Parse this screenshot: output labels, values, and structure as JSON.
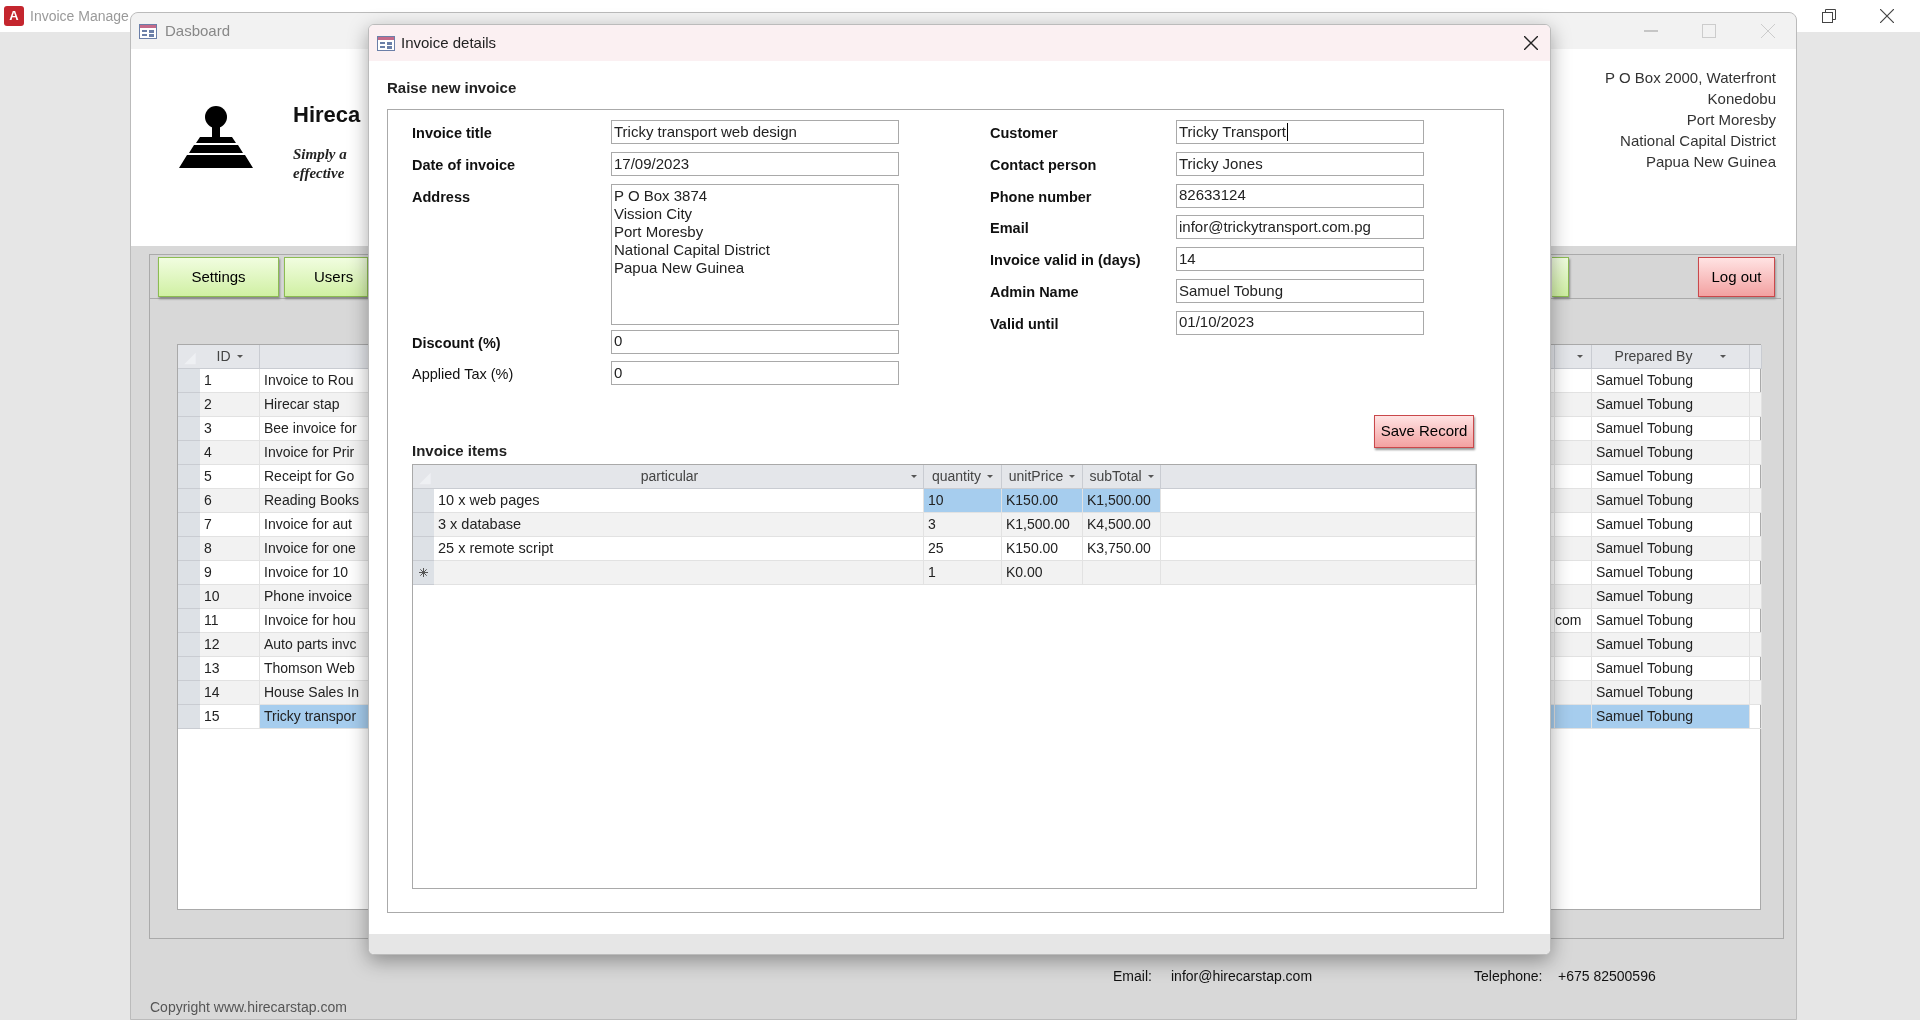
{
  "app": {
    "icon_letter": "A",
    "title": "Invoice Manage"
  },
  "dashboard": {
    "title": "Dasboard",
    "brand": "Hireca",
    "tagline": [
      "Simply a",
      "effective"
    ],
    "address": [
      "P O Box 2000, Waterfront",
      "Konedobu",
      "Port Moresby",
      "National Capital District",
      "Papua New Guinea"
    ],
    "nav_buttons": [
      {
        "label": "Settings"
      },
      {
        "label": "Users"
      }
    ],
    "logout": "Log out",
    "invoices": {
      "columns": [
        "ID",
        "Prepared By"
      ],
      "rows": [
        {
          "id": "1",
          "title": "Invoice to Rou",
          "prepared_by": "Samuel Tobung",
          "selected": false
        },
        {
          "id": "2",
          "title": "Hirecar stap",
          "prepared_by": "Samuel Tobung",
          "selected": false
        },
        {
          "id": "3",
          "title": "Bee invoice for",
          "prepared_by": "Samuel Tobung",
          "selected": false
        },
        {
          "id": "4",
          "title": "Invoice for Prir",
          "prepared_by": "Samuel Tobung",
          "selected": false
        },
        {
          "id": "5",
          "title": "Receipt for Go",
          "prepared_by": "Samuel Tobung",
          "selected": false
        },
        {
          "id": "6",
          "title": "Reading Books",
          "prepared_by": "Samuel Tobung",
          "selected": false
        },
        {
          "id": "7",
          "title": "Invoice for aut",
          "prepared_by": "Samuel Tobung",
          "selected": false
        },
        {
          "id": "8",
          "title": "Invoice for one",
          "prepared_by": "Samuel Tobung",
          "selected": false
        },
        {
          "id": "9",
          "title": "Invoice for 10",
          "prepared_by": "Samuel Tobung",
          "selected": false
        },
        {
          "id": "10",
          "title": "Phone invoice",
          "prepared_by": "Samuel Tobung",
          "selected": false
        },
        {
          "id": "11",
          "title": "Invoice for hou",
          "column_3": "com",
          "prepared_by": "Samuel Tobung",
          "selected": false
        },
        {
          "id": "12",
          "title": "Auto parts invc",
          "prepared_by": "Samuel Tobung",
          "selected": false
        },
        {
          "id": "13",
          "title": "Thomson Web",
          "prepared_by": "Samuel Tobung",
          "selected": false
        },
        {
          "id": "14",
          "title": "House Sales In",
          "prepared_by": "Samuel Tobung",
          "selected": false
        },
        {
          "id": "15",
          "title": "Tricky transpor",
          "prepared_by": "Samuel Tobung",
          "selected": true
        }
      ]
    },
    "footer": {
      "email_label": "Email:",
      "email": "infor@hirecarstap.com",
      "phone_label": "Telephone:",
      "phone": "+675 82500596",
      "copyright": "Copyright www.hirecarstap.com"
    }
  },
  "modal": {
    "title": "Invoice details",
    "heading": "Raise new invoice",
    "fields_left": [
      {
        "label": "Invoice title",
        "value": "Tricky transport web design",
        "kind": "text",
        "bold": true
      },
      {
        "label": "Date of invoice",
        "value": "17/09/2023",
        "kind": "text",
        "bold": true
      },
      {
        "label": "Address",
        "lines": [
          "P O Box 3874",
          "Vission City",
          "Port Moresby",
          "National Capital District",
          "Papua New Guinea"
        ],
        "kind": "multiline",
        "bold": true
      },
      {
        "label": "Discount (%)",
        "value": "0",
        "kind": "text",
        "bold": true
      },
      {
        "label": "Applied Tax (%)",
        "value": "0",
        "kind": "text",
        "bold": false
      }
    ],
    "fields_right": [
      {
        "label": "Customer",
        "value": "Tricky Transport",
        "kind": "text",
        "focused": true
      },
      {
        "label": "Contact person",
        "value": "Tricky Jones",
        "kind": "text",
        "focused": false
      },
      {
        "label": "Phone number",
        "value": "82633124",
        "kind": "text",
        "focused": false
      },
      {
        "label": "Email",
        "value": "infor@trickytransport.com.pg",
        "kind": "text",
        "focused": false
      },
      {
        "label": "Invoice valid in (days)",
        "value": "14",
        "kind": "text",
        "focused": false
      },
      {
        "label": "Admin Name",
        "value": "Samuel Tobung",
        "kind": "text",
        "focused": false
      },
      {
        "label": "Valid until",
        "value": "01/10/2023",
        "kind": "text",
        "focused": false
      }
    ],
    "save": "Save Record",
    "items_heading": "Invoice items",
    "items": {
      "columns": [
        "particular",
        "quantity",
        "unitPrice",
        "subTotal"
      ],
      "rows": [
        {
          "kind": "data",
          "selected": true,
          "cells": [
            "10 x web pages",
            "10",
            "K150.00",
            "K1,500.00"
          ]
        },
        {
          "kind": "data",
          "selected": false,
          "cells": [
            "3 x database",
            "3",
            "K1,500.00",
            "K4,500.00"
          ]
        },
        {
          "kind": "data",
          "selected": false,
          "cells": [
            "25 x remote script",
            "25",
            "K150.00",
            "K3,750.00"
          ]
        },
        {
          "kind": "new",
          "selected": false,
          "cells": [
            "",
            "1",
            "K0.00",
            ""
          ]
        }
      ]
    }
  }
}
